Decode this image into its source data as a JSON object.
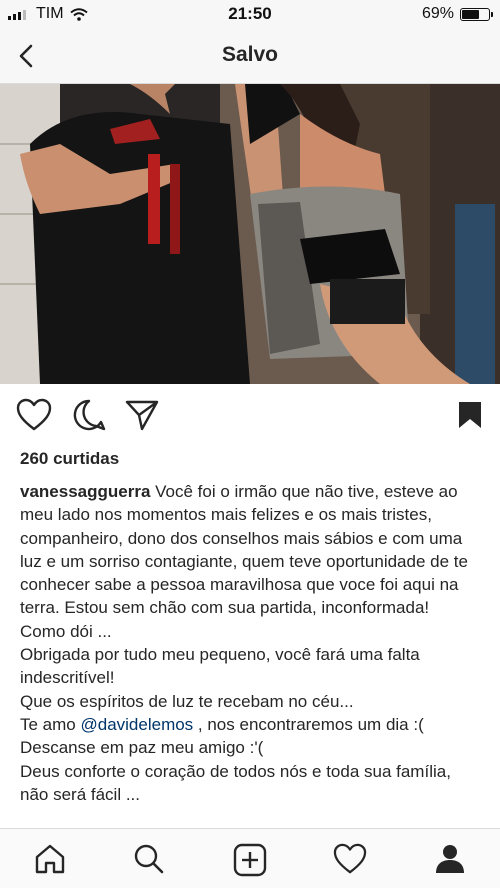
{
  "status_bar": {
    "carrier": "TIM",
    "time": "21:50",
    "battery_text": "69%",
    "battery_level": 0.69
  },
  "nav": {
    "title": "Salvo",
    "back_icon": "chevron-left-icon"
  },
  "post": {
    "likes_text": "260 curtidas",
    "caption": {
      "username": "vanessagguerra",
      "line1": " Você  foi o irmão que não tive, esteve ao meu lado nos momentos mais felizes e os mais tristes, companheiro, dono dos conselhos mais sábios e com uma luz e um sorriso contagiante, quem teve oportunidade de te conhecer sabe a pessoa maravilhosa que voce foi aqui na terra.  Estou sem chão com sua partida, inconformada!",
      "line2": "Como dói ...",
      "line3": "Obrigada por tudo meu pequeno, você fará uma falta indescritível!",
      "line4": "Que os espíritos de luz te recebam no céu...",
      "line5_prefix": "Te amo ",
      "mention": "@davidelemos",
      "line5_suffix": " , nos encontraremos um dia :(",
      "line6": "Descanse em paz meu amigo :'(",
      "line7": "Deus conforte o coração de todos nós e toda sua família, não será fácil ..."
    },
    "actions": [
      "heart-icon",
      "comment-icon",
      "share-icon",
      "bookmark-icon"
    ]
  },
  "tab_bar": [
    "home-icon",
    "search-icon",
    "add-post-icon",
    "activity-heart-icon",
    "profile-icon"
  ],
  "colors": {
    "bar_background": "#f7f7f7",
    "text": "#262626",
    "mention": "#003569",
    "divider": "#dbdbdb"
  }
}
